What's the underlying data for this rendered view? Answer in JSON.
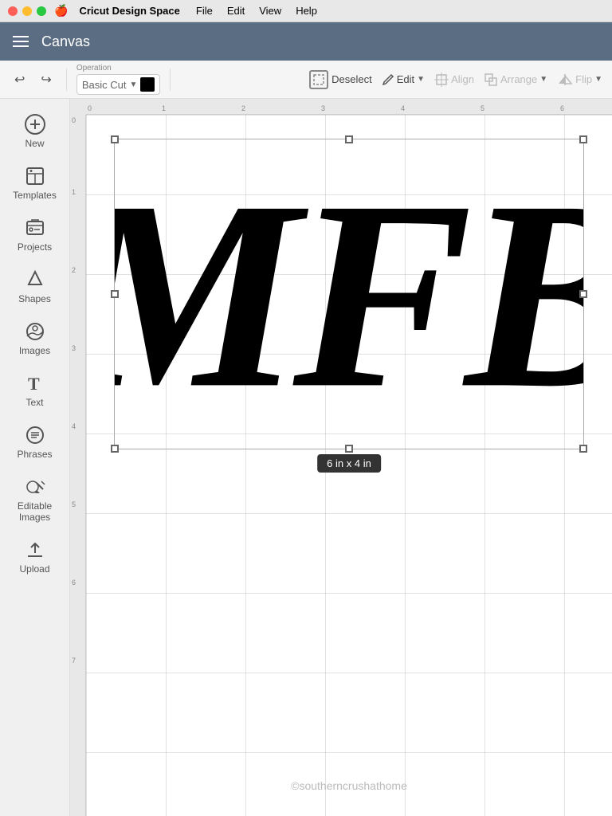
{
  "titleBar": {
    "apple": "🍎",
    "appName": "Cricut Design Space",
    "menus": [
      "File",
      "Edit",
      "View",
      "Help"
    ]
  },
  "header": {
    "title": "Canvas",
    "hamburger": "menu"
  },
  "toolbar": {
    "operation_label": "Operation",
    "operation_value": "Basic Cut",
    "deselect_label": "Deselect",
    "edit_label": "Edit",
    "align_label": "Align",
    "arrange_label": "Arrange",
    "flip_label": "Flip"
  },
  "sidebar": {
    "items": [
      {
        "id": "new",
        "label": "New",
        "icon": "new"
      },
      {
        "id": "templates",
        "label": "Templates",
        "icon": "templates"
      },
      {
        "id": "projects",
        "label": "Projects",
        "icon": "projects"
      },
      {
        "id": "shapes",
        "label": "Shapes",
        "icon": "shapes"
      },
      {
        "id": "images",
        "label": "Images",
        "icon": "images"
      },
      {
        "id": "text",
        "label": "Text",
        "icon": "text"
      },
      {
        "id": "phrases",
        "label": "Phrases",
        "icon": "phrases"
      },
      {
        "id": "editable-images",
        "label": "Editable Images",
        "icon": "editable-images"
      },
      {
        "id": "upload",
        "label": "Upload",
        "icon": "upload"
      }
    ]
  },
  "canvas": {
    "rulers": {
      "top": [
        "0",
        "1",
        "2",
        "3",
        "4",
        "5",
        "6"
      ],
      "left": [
        "0",
        "1",
        "2",
        "3",
        "4",
        "5",
        "6",
        "7"
      ]
    },
    "sizeLabel": "6 in x 4 in",
    "watermark": "©southerncrushathome",
    "monogram": "MFB"
  }
}
